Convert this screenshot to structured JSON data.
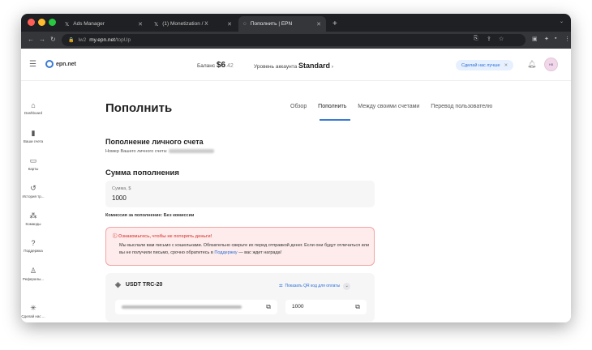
{
  "browser": {
    "tabs": [
      {
        "label": "Ads Manager",
        "icon": "𝕏"
      },
      {
        "label": "(1) Monetization / X",
        "icon": "𝕏"
      },
      {
        "label": "Пополнить | EPN",
        "icon": "◌"
      }
    ],
    "new_tab": "+",
    "url_host": "my.epn.net",
    "url_path": "/topUp",
    "url_prefix": "lw2"
  },
  "header": {
    "logo": "epn.net",
    "balance_label": "Баланс",
    "balance_main": "$6",
    "balance_cents": ".42",
    "level_label": "Уровень аккаунта",
    "level_value": "Standard",
    "promo": "Сделай нас лучше",
    "avatar": "НВ"
  },
  "sidebar": [
    {
      "label": "Dashboard",
      "icon": "⌂"
    },
    {
      "label": "Ваши счета",
      "icon": "▮"
    },
    {
      "label": "Карты",
      "icon": "▭"
    },
    {
      "label": "История тр...",
      "icon": "↺"
    },
    {
      "label": "Команды",
      "icon": "⁂"
    },
    {
      "label": "Поддержка",
      "icon": "?"
    },
    {
      "label": "Рефералы...",
      "icon": "♙"
    },
    {
      "label": "Сделай нас ...",
      "icon": "✳"
    }
  ],
  "main": {
    "title": "Пополнить",
    "tabs": [
      "Обзор",
      "Пополнить",
      "Между своими счетами",
      "Перевод пользователю"
    ],
    "section_title": "Пополнение личного счета",
    "account_label": "Номер Вашего личного счета:",
    "amount_title": "Сумма пополнения",
    "amount_label": "Сумма, $",
    "amount_value": "1000",
    "commission": "Комиссия за пополнение: Без комиссии",
    "warning_title": "Ознакомьтесь, чтобы не потерять деньги!",
    "warning_text_1": "Мы выслали вам письмо с кошельками. Обязательно сверьте их перед отправкой денег. Если они будут отличаться или вы не получили письмо, срочно обратитесь в ",
    "warning_link": "Поддержку",
    "warning_text_2": " — вас ждет награда!",
    "currency": "USDT TRC-20",
    "qr_label": "Показать QR код для оплаты",
    "pay_amount": "1000"
  }
}
